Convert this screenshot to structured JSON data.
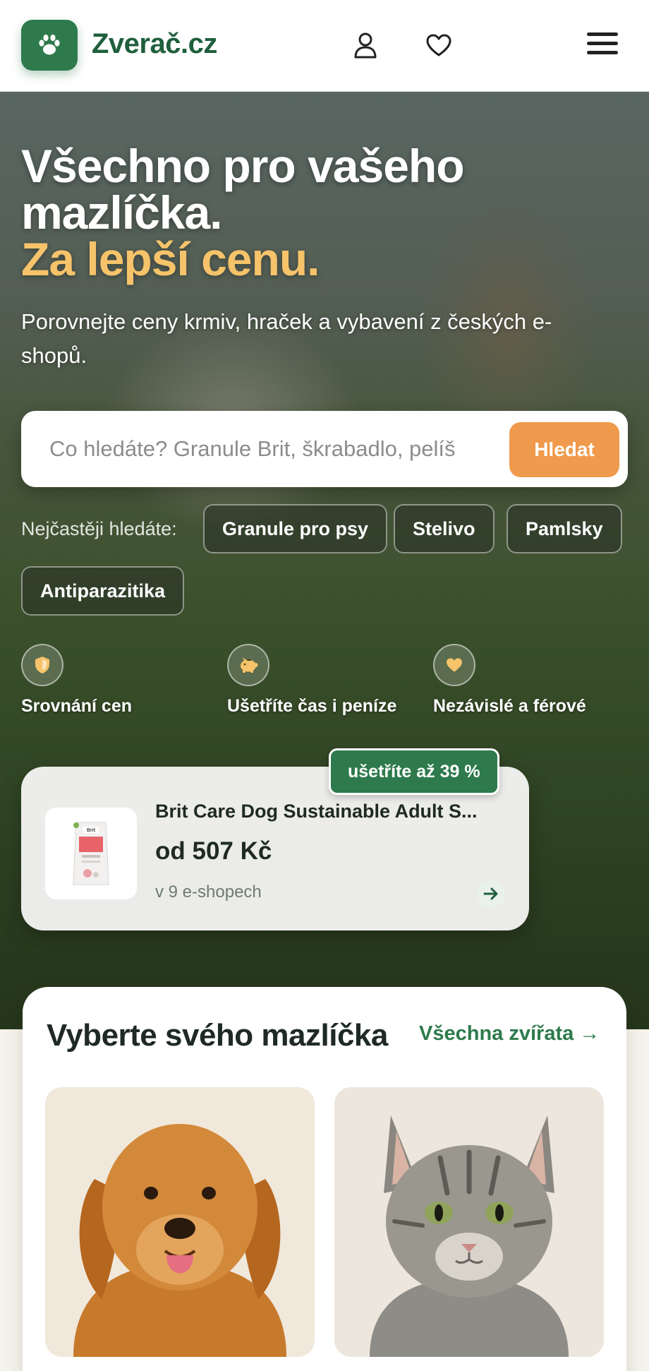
{
  "header": {
    "brand": "Zverač.cz",
    "icons": [
      "paw-icon",
      "user-icon",
      "heart-icon",
      "menu-icon"
    ]
  },
  "hero": {
    "title_line1": "Všechno pro vašeho",
    "title_line2": "mazlíčka.",
    "title_accent": "Za lepší cenu.",
    "subtitle": "Porovnejte ceny krmiv, hraček a vybavení z českých e-shopů.",
    "search": {
      "placeholder": "Co hledáte? Granule Brit, škrabadlo, pelíš",
      "value": "",
      "button": "Hledat"
    },
    "popular": {
      "label": "Nejčastěji hledáte:",
      "chips": [
        "Granule pro psy",
        "Stelivo",
        "Pamlsky",
        "Antiparazitika"
      ]
    },
    "features": [
      {
        "label": "Srovnání cen",
        "icon": "shield-icon"
      },
      {
        "label": "Ušetříte čas i peníze",
        "icon": "piggy-bank-icon"
      },
      {
        "label": "Nezávislé a férové",
        "icon": "heart-icon"
      }
    ],
    "deal": {
      "badge": "ušetříte až 39 %",
      "product_name": "Brit Care Dog Sustainable Adult S...",
      "price": "od 507 Kč",
      "shops": "v 9 e-shopech",
      "image_text": "Brit"
    }
  },
  "pets": {
    "title": "Vyberte svého mazlíčka",
    "all_link": "Všechna zvířata →",
    "cards": [
      {
        "animal": "dog"
      },
      {
        "animal": "cat"
      }
    ]
  },
  "colors": {
    "brand_green": "#2e7a4c",
    "accent_orange": "#ef9a4c",
    "accent_yellow": "#f6c36a"
  }
}
